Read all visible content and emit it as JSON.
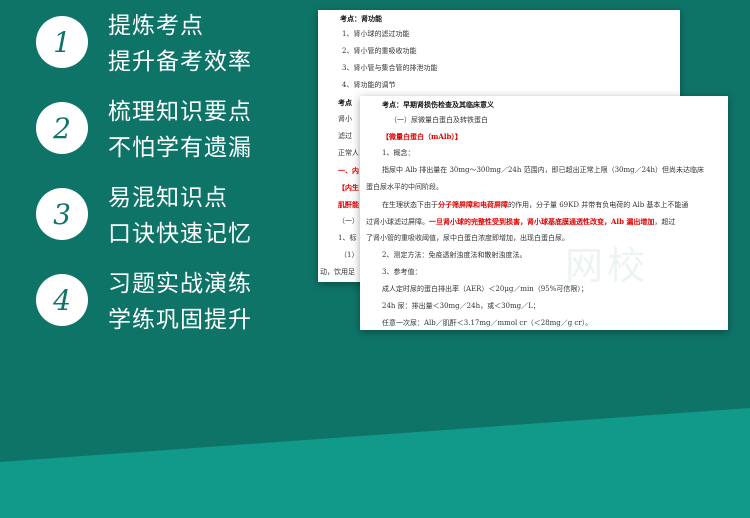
{
  "features": [
    {
      "number": "1",
      "line1": "提炼考点",
      "line2": "提升备考效率"
    },
    {
      "number": "2",
      "line1": "梳理知识要点",
      "line2": "不怕学有遗漏"
    },
    {
      "number": "3",
      "line1": "易混知识点",
      "line2": "口诀快速记忆"
    },
    {
      "number": "4",
      "line1": "习题实战演练",
      "line2": "学练巩固提升"
    }
  ],
  "doc_back": {
    "title": "考点：肾功能",
    "items": [
      "1、肾小球的滤过功能",
      "2、肾小管的重吸收功能",
      "3、肾小管与集合管的排泄功能",
      "4、肾功能的调节"
    ],
    "frag_kaodian": "考点",
    "frag_lines": [
      "肾小",
      "滤过",
      "正常人",
      "一、内",
      "【内生",
      "肌酐能",
      "（一）",
      "1、标",
      "（1）",
      "动，饮用足"
    ]
  },
  "doc_front": {
    "title": "考点：早期肾损伤检查及其临床意义",
    "section": "（一）尿微量白蛋白及转铁蛋白",
    "heading": "【微量白蛋白（mAlb）】",
    "concept": "1、概念：",
    "p1": "指尿中 Alb 排出量在 30mg～300mg／24h 范围内，即已超出正常上限（30mg／24h）但尚未达临床",
    "p1b": "蛋白尿水平的中间阶段。",
    "p2a": "在生理状态下由于",
    "p2red1": "分子筛屏障和电荷屏障",
    "p2b": "的作用，分子量 69KD 并带有负电荷的 Alb 基本上不能通",
    "p3a": "过肾小球滤过屏障。",
    "p3red": "一旦肾小球的完整性受到损害，肾小球基底膜通透性改变，Alb 漏出增加",
    "p3b": "，超过",
    "p4": "了肾小管的重吸收阈值，尿中白蛋白浓度即增加，出现白蛋白尿。",
    "method": "2、测定方法：免疫透射浊度法和散射浊度法。",
    "ref": "3、参考值：",
    "r1": "成人定时尿的蛋白排出率（AER）＜20μg／min（95%可信限）；",
    "r2": "24h 尿：排出量＜30mg／24h，或＜30mg／L；",
    "r3": "任意一次尿：Alb／肌酐＜3.17mg／mmol cr（＜28mg／g cr）。"
  },
  "watermark": "网校"
}
